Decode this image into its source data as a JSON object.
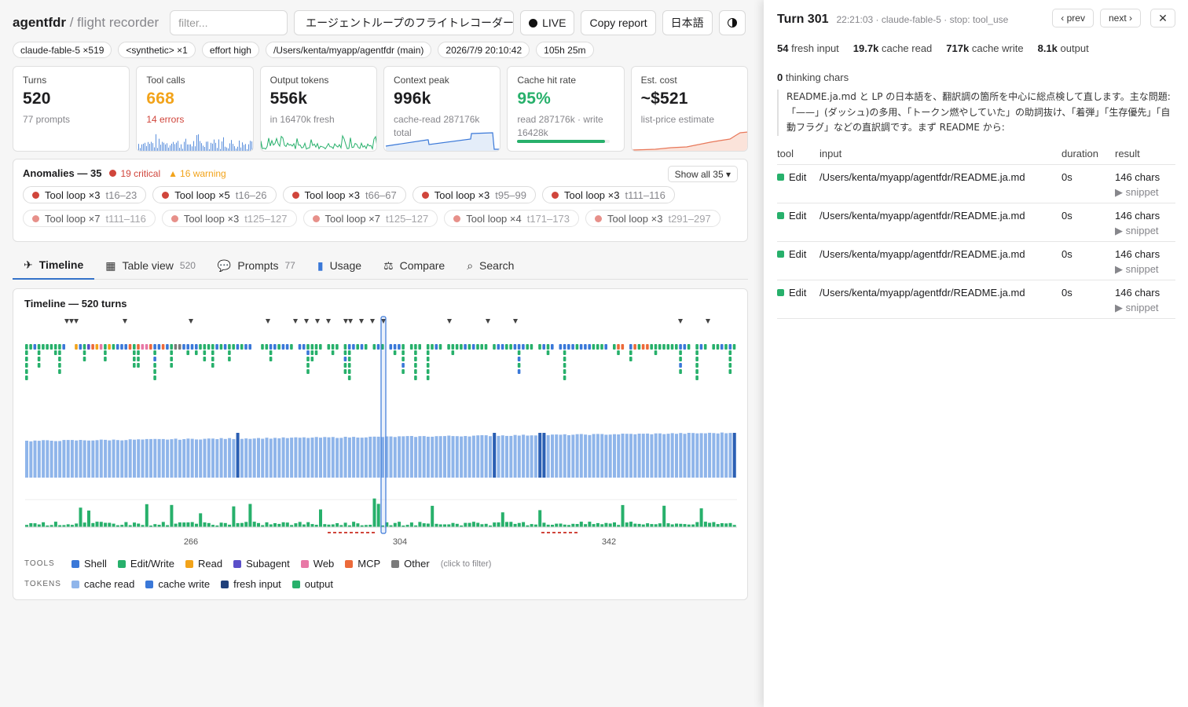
{
  "header": {
    "brand": "agentfdr",
    "brand_sub": "/ flight recorder",
    "filter_placeholder": "filter...",
    "session_select": "エージェントループのフライトレコーダー",
    "live_label": "LIVE",
    "copy_report_label": "Copy report",
    "language_label": "日本語"
  },
  "chips": [
    "claude-fable-5 ×519",
    "<synthetic> ×1",
    "effort high",
    "/Users/kenta/myapp/agentfdr (main)",
    "2026/7/9 20:10:42",
    "105h 25m"
  ],
  "stats": {
    "turns": {
      "label": "Turns",
      "value": "520",
      "sub": "77 prompts"
    },
    "tool_calls": {
      "label": "Tool calls",
      "value": "668",
      "sub": "14 errors"
    },
    "output_tokens": {
      "label": "Output tokens",
      "value": "556k",
      "sub": "in 16470k fresh"
    },
    "context_peak": {
      "label": "Context peak",
      "value": "996k",
      "sub": "cache-read 287176k total"
    },
    "cache_hit": {
      "label": "Cache hit rate",
      "value": "95%",
      "sub": "read 287176k · write 16428k",
      "fraction": 0.95
    },
    "est_cost": {
      "label": "Est. cost",
      "value": "~$521",
      "sub": "list-price estimate"
    }
  },
  "anomalies": {
    "title": "Anomalies — 35",
    "critical": "19 critical",
    "warning": "16 warning",
    "show_all": "Show all 35 ▾",
    "items": [
      {
        "label": "Tool loop ×3",
        "range": "t16–23"
      },
      {
        "label": "Tool loop ×5",
        "range": "t16–26"
      },
      {
        "label": "Tool loop ×3",
        "range": "t66–67"
      },
      {
        "label": "Tool loop ×3",
        "range": "t95–99"
      },
      {
        "label": "Tool loop ×3",
        "range": "t111–116"
      },
      {
        "label": "Tool loop ×7",
        "range": "t111–116"
      },
      {
        "label": "Tool loop ×3",
        "range": "t125–127"
      },
      {
        "label": "Tool loop ×7",
        "range": "t125–127"
      },
      {
        "label": "Tool loop ×4",
        "range": "t171–173"
      },
      {
        "label": "Tool loop ×3",
        "range": "t291–297"
      }
    ]
  },
  "tabs": [
    {
      "label": "Timeline",
      "count": "",
      "icon": "plane-icon"
    },
    {
      "label": "Table view",
      "count": "520",
      "icon": "table-icon"
    },
    {
      "label": "Prompts",
      "count": "77",
      "icon": "chat-icon"
    },
    {
      "label": "Usage",
      "count": "",
      "icon": "chart-icon"
    },
    {
      "label": "Compare",
      "count": "",
      "icon": "scale-icon"
    },
    {
      "label": "Search",
      "count": "",
      "icon": "search-icon"
    }
  ],
  "timeline": {
    "title": "Timeline — 520 turns",
    "axis_labels": [
      "266",
      "304",
      "342"
    ],
    "tools_caption": "TOOLS",
    "tokens_caption": "TOKENS",
    "tools_legend": [
      {
        "label": "Shell",
        "color": "#3a78d8"
      },
      {
        "label": "Edit/Write",
        "color": "#27b06b"
      },
      {
        "label": "Read",
        "color": "#f2a31a"
      },
      {
        "label": "Subagent",
        "color": "#5b4fc9"
      },
      {
        "label": "Web",
        "color": "#e878a6"
      },
      {
        "label": "MCP",
        "color": "#ec6a3a"
      },
      {
        "label": "Other",
        "color": "#7a7a7a"
      }
    ],
    "tools_hint": "(click to filter)",
    "tokens_legend": [
      {
        "label": "cache read",
        "color": "#8fb5ea"
      },
      {
        "label": "cache write",
        "color": "#3a78d8"
      },
      {
        "label": "fresh input",
        "color": "#1f3f7a"
      },
      {
        "label": "output",
        "color": "#27b06b"
      }
    ]
  },
  "detail": {
    "title": "Turn 301",
    "meta": "22:21:03 · claude-fable-5 · stop: tool_use",
    "prev": "‹ prev",
    "next": "next ›",
    "close": "✕",
    "usage": [
      {
        "value": "54",
        "label": "fresh input"
      },
      {
        "value": "19.7k",
        "label": "cache read"
      },
      {
        "value": "717k",
        "label": "cache write"
      },
      {
        "value": "8.1k",
        "label": "output"
      }
    ],
    "thinking_value": "0",
    "thinking_label": "thinking chars",
    "text": "README.ja.md と LP の日本語を、翻訳調の箇所を中心に総点検して直します。主な問題: 「——」(ダッシュ)の多用、「トークン燃やしていた」の助詞抜け、「着弾」「生存優先」「自動フラグ」などの直訳調です。まず README から:",
    "columns": [
      "tool",
      "input",
      "duration",
      "result"
    ],
    "rows": [
      {
        "tool": "Edit",
        "input": "/Users/kenta/myapp/agentfdr/README.ja.md",
        "duration": "0s",
        "result": "146 chars",
        "snippet": "▶ snippet"
      },
      {
        "tool": "Edit",
        "input": "/Users/kenta/myapp/agentfdr/README.ja.md",
        "duration": "0s",
        "result": "146 chars",
        "snippet": "▶ snippet"
      },
      {
        "tool": "Edit",
        "input": "/Users/kenta/myapp/agentfdr/README.ja.md",
        "duration": "0s",
        "result": "146 chars",
        "snippet": "▶ snippet"
      },
      {
        "tool": "Edit",
        "input": "/Users/kenta/myapp/agentfdr/README.ja.md",
        "duration": "0s",
        "result": "146 chars",
        "snippet": "▶ snippet"
      }
    ]
  }
}
